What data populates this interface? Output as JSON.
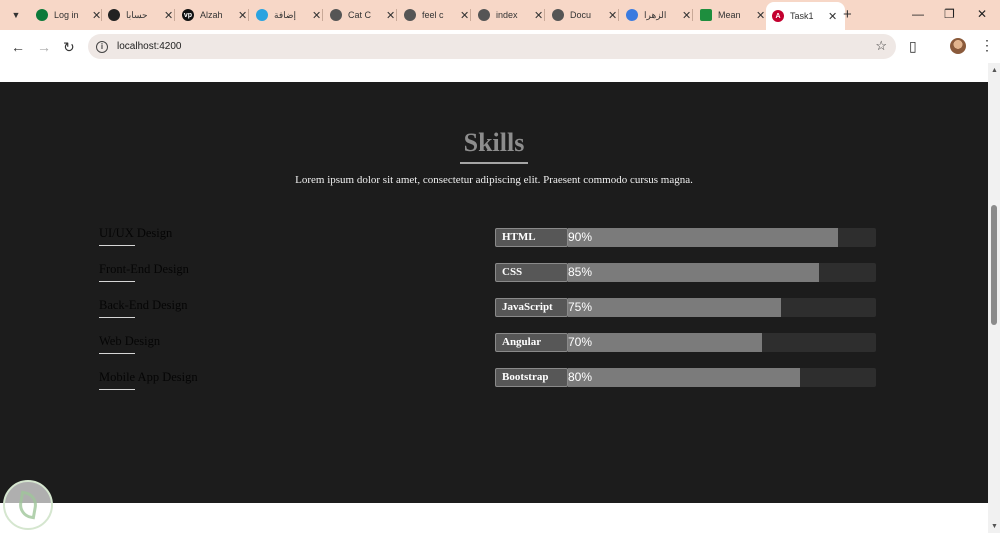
{
  "browser": {
    "tabs": [
      {
        "label": "Log in",
        "favicon_color": "#0c7a3a",
        "active": false
      },
      {
        "label": "حسابا",
        "favicon_color": "#222222",
        "active": false
      },
      {
        "label": "Alzah",
        "favicon_color": "#111111",
        "active": false
      },
      {
        "label": "إضافة",
        "favicon_color": "#2aa3e0",
        "active": false
      },
      {
        "label": "Cat C",
        "favicon_color": "#555555",
        "active": false
      },
      {
        "label": "feel c",
        "favicon_color": "#555555",
        "active": false
      },
      {
        "label": "index",
        "favicon_color": "#555555",
        "active": false
      },
      {
        "label": "Docu",
        "favicon_color": "#555555",
        "active": false
      },
      {
        "label": "الزهرا",
        "favicon_color": "#3a7be0",
        "active": false
      },
      {
        "label": "Mean",
        "favicon_color": "#1e8e3e",
        "active": false
      },
      {
        "label": "Task1",
        "favicon_color": "#c3002f",
        "active": true
      }
    ],
    "url": "localhost:4200"
  },
  "skills": {
    "title": "Skills",
    "subtitle": "Lorem ipsum dolor sit amet, consectetur adipiscing elit. Praesent commodo cursus magna.",
    "areas": [
      "UI/UX Design",
      "Front-End Design",
      "Back-End Design",
      "Web Design",
      "Mobile App Design"
    ],
    "bars": [
      {
        "label": "HTML",
        "percent": 90,
        "percent_text": "90%"
      },
      {
        "label": "CSS",
        "percent": 85,
        "percent_text": "85%"
      },
      {
        "label": "JavaScript",
        "percent": 75,
        "percent_text": "75%"
      },
      {
        "label": "Angular",
        "percent": 70,
        "percent_text": "70%"
      },
      {
        "label": "Bootstrap",
        "percent": 80,
        "percent_text": "80%"
      }
    ]
  },
  "colors": {
    "section_bg": "#1c1c1c",
    "bar_fill": "#7b7b7b",
    "bar_track": "#2e2e2e",
    "title": "#8d8d8d"
  }
}
